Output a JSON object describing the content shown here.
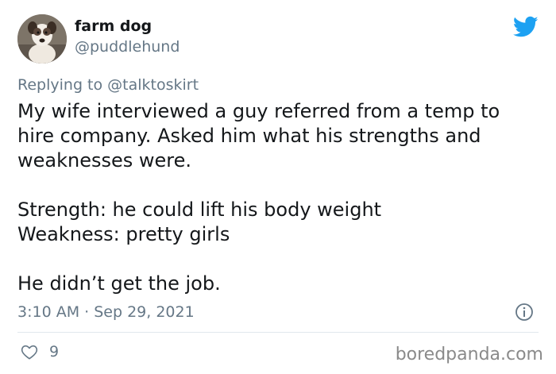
{
  "user": {
    "display_name": "farm dog",
    "handle": "@puddlehund"
  },
  "reply": {
    "prefix": "Replying to ",
    "mention": "@talktoskirt"
  },
  "tweet": {
    "paragraph_1": "My wife interviewed a guy referred from a temp to hire company. Asked him what his strengths and weaknesses were.",
    "paragraph_2": "Strength: he could lift his body weight\nWeakness: pretty girls",
    "paragraph_3": "He didn’t get the job.",
    "timestamp": "3:10 AM · Sep 29, 2021"
  },
  "engagement": {
    "likes": "9"
  },
  "watermark": "boredpanda.com",
  "icons": {
    "twitter": "twitter-bird-icon",
    "info": "info-icon",
    "like": "heart-icon"
  },
  "colors": {
    "twitter_blue": "#1da1f2",
    "secondary_text": "#657786",
    "primary_text": "#14171a"
  }
}
